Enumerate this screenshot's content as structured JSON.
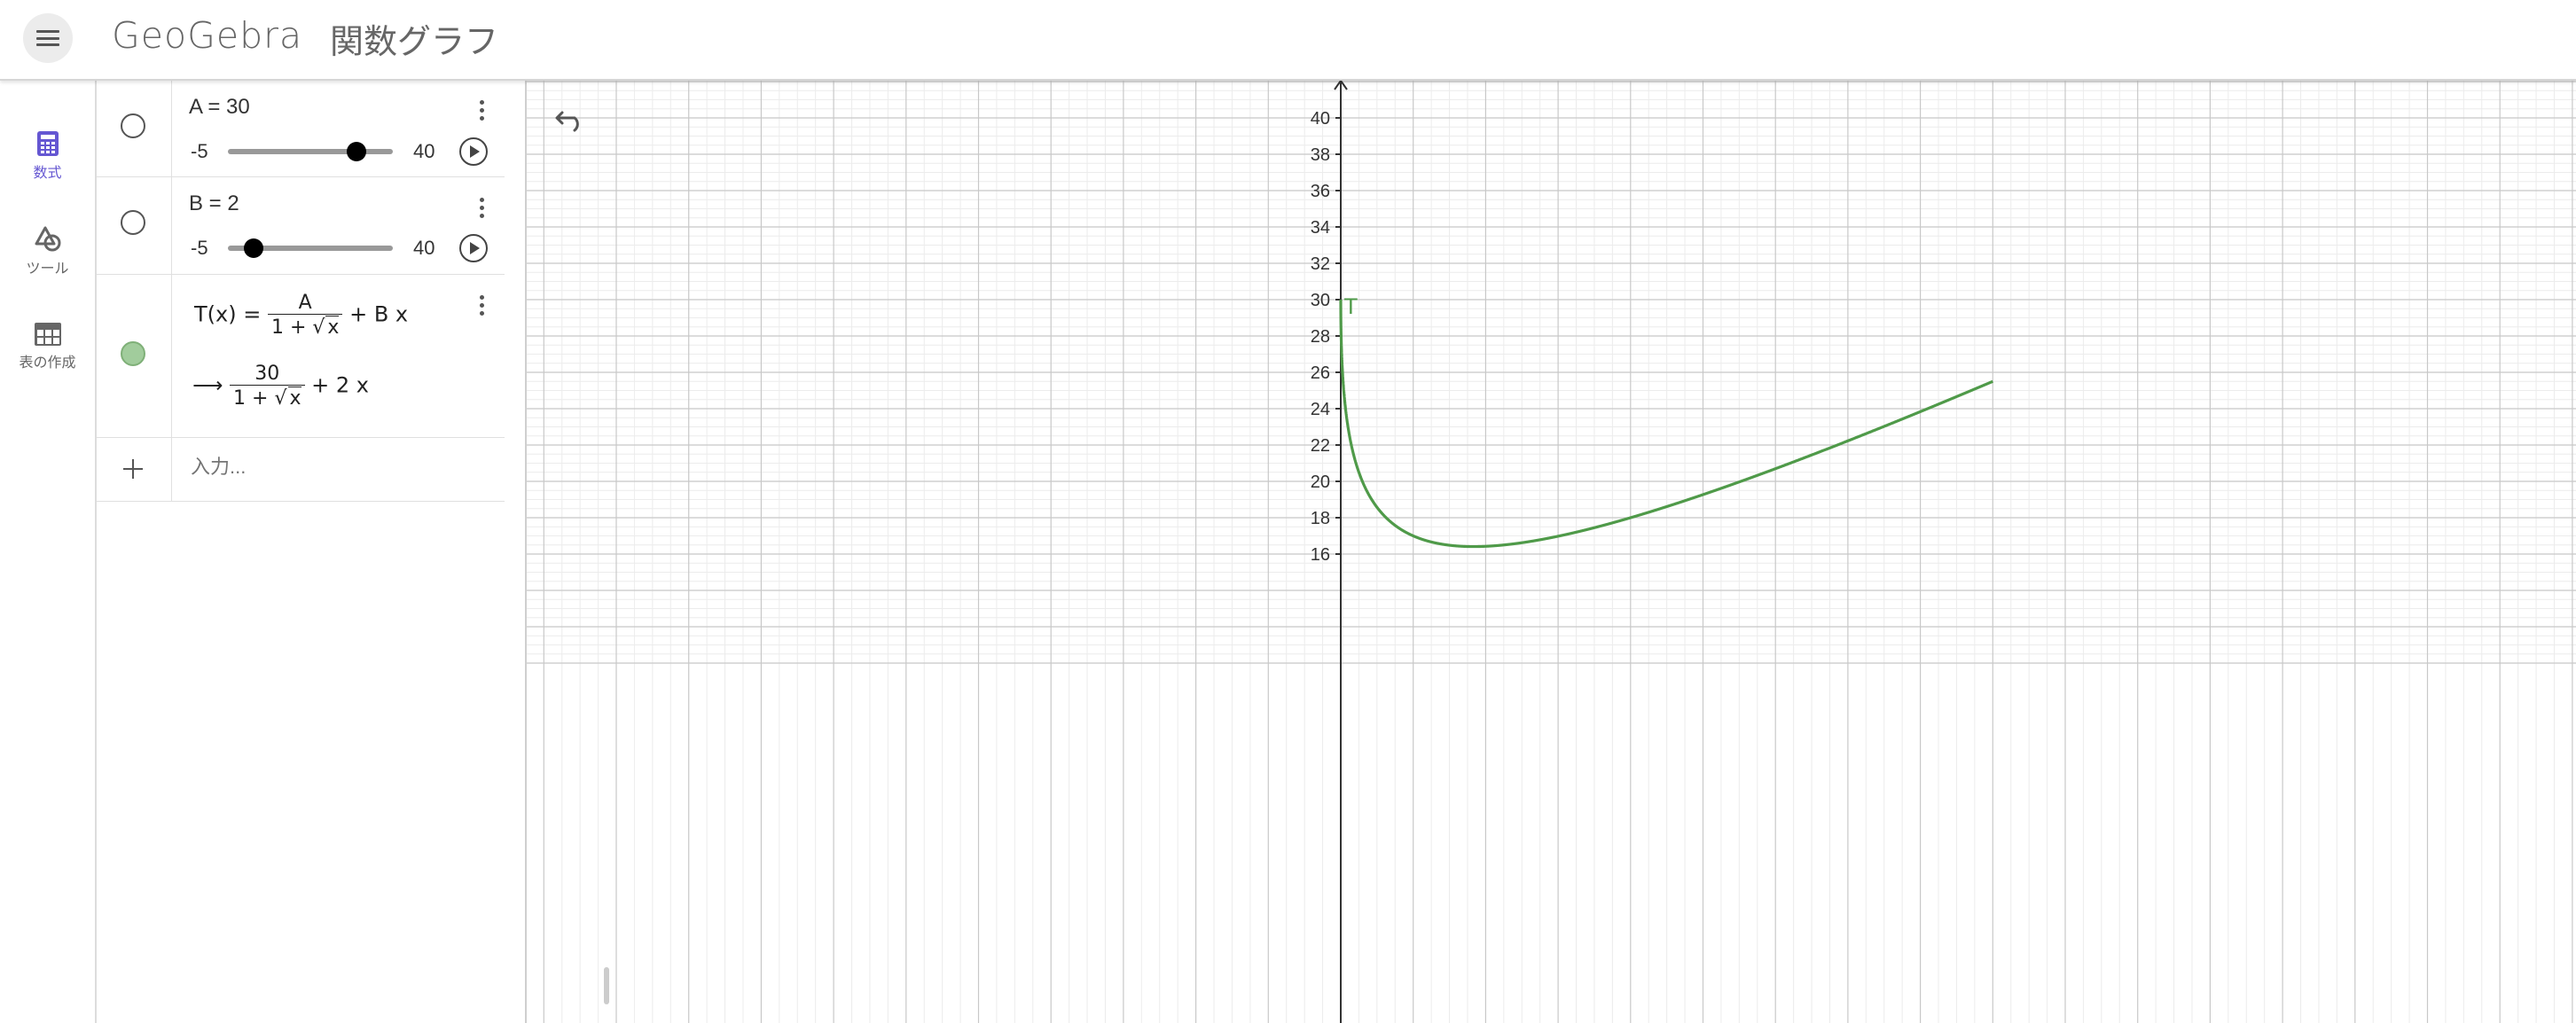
{
  "header": {
    "brand": "GeoGebra",
    "title": "関数グラフ"
  },
  "nav": {
    "items": [
      {
        "label": "数式",
        "icon": "calculator-icon",
        "active": true
      },
      {
        "label": "ツール",
        "icon": "shapes-icon",
        "active": false
      },
      {
        "label": "表の作成",
        "icon": "table-icon",
        "active": false
      }
    ],
    "active_color": "#6557d2"
  },
  "algebra": {
    "slider_a": {
      "label": "A = 30",
      "value": 30,
      "min": -5,
      "max": 40,
      "min_label": "-5",
      "max_label": "40"
    },
    "slider_b": {
      "label": "B = 2",
      "value": 2,
      "min": -5,
      "max": 40,
      "min_label": "-5",
      "max_label": "40"
    },
    "function": {
      "lhs": "T(x) =",
      "numerator": "A",
      "denominator_prefix": "1 +",
      "radicand": "x",
      "tail": "+ B x",
      "arrow": "⟶",
      "value_numerator": "30",
      "value_tail": "+ 2 x",
      "color": "#5a9656"
    },
    "input_placeholder": "入力..."
  },
  "graph": {
    "y_ticks": [
      "16",
      "18",
      "20",
      "22",
      "24",
      "26",
      "28",
      "30",
      "32",
      "34",
      "36",
      "38",
      "40"
    ],
    "function_label": "T",
    "curve_color": "#4f9a49",
    "chart_data": {
      "type": "line",
      "series": [
        {
          "name": "T",
          "function": "30/(1+sqrt(x)) + 2x",
          "A": 30,
          "B": 2
        }
      ],
      "ylim": [
        15.2,
        41
      ],
      "grid": true
    }
  }
}
